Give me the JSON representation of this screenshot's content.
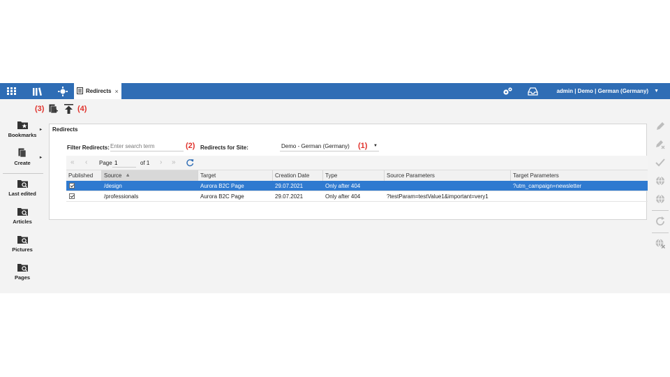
{
  "topbar": {
    "tab_title": "Redirects",
    "tab_close": "×",
    "user": "admin | Demo | German (Germany)",
    "user_caret": "▼"
  },
  "annotations": {
    "a1": "(1)",
    "a2": "(2)",
    "a3": "(3)",
    "a4": "(4)"
  },
  "sidebar": {
    "items": [
      {
        "label": "Bookmarks",
        "icon": "bookmarks-folder-icon"
      },
      {
        "label": "Create",
        "icon": "create-document-icon"
      },
      {
        "label": "Last edited",
        "icon": "last-edited-folder-icon"
      },
      {
        "label": "Articles",
        "icon": "articles-folder-icon"
      },
      {
        "label": "Pictures",
        "icon": "pictures-folder-icon"
      },
      {
        "label": "Pages",
        "icon": "pages-folder-icon"
      }
    ],
    "arrow": "▸"
  },
  "panel": {
    "title": "Redirects",
    "filter_label": "Filter Redirects:",
    "search_placeholder": "Enter search term",
    "site_label": "Redirects for Site:",
    "site_value": "Demo - German (Germany)",
    "site_caret": "▼"
  },
  "paging": {
    "page_label": "Page",
    "page_value": "1",
    "of_label": "of 1"
  },
  "table": {
    "columns": [
      "Published",
      "Source",
      "Target",
      "Creation Date",
      "Type",
      "Source Parameters",
      "Target Parameters"
    ],
    "sort_indicator": "≜",
    "rows": [
      {
        "published": true,
        "source": "/design",
        "target": "Aurora B2C Page",
        "date": "29.07.2021",
        "type": "Only after 404",
        "source_params": "",
        "target_params": "?utm_campaign=newsletter"
      },
      {
        "published": true,
        "source": "/professionals",
        "target": "Aurora B2C Page",
        "date": "29.07.2021",
        "type": "Only after 404",
        "source_params": "?testParam=testValue1&important=very1",
        "target_params": ""
      }
    ]
  },
  "colors": {
    "topbar": "#2f6db5",
    "selected_row": "#2f7ad0",
    "annotation": "#e0302a"
  }
}
